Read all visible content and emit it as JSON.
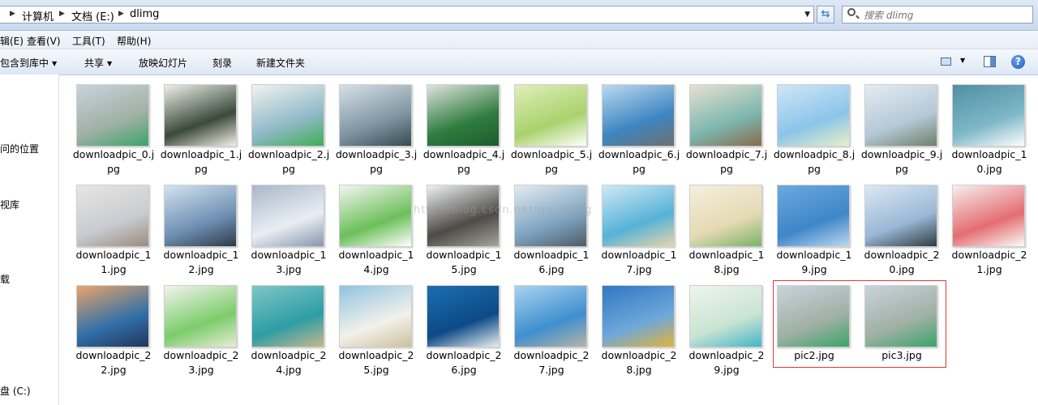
{
  "address": {
    "crumbs": [
      "计算机",
      "文档 (E:)",
      "dlimg"
    ]
  },
  "search": {
    "placeholder": "搜索 dlimg"
  },
  "menu": [
    "辑(E)",
    "查看(V)",
    "工具(T)",
    "帮助(H)"
  ],
  "toolbar": {
    "include_library": "包含到库中",
    "share": "共享",
    "slideshow": "放映幻灯片",
    "burn": "刻录",
    "new_folder": "新建文件夹"
  },
  "nav": [
    "问的位置",
    "视库",
    "载",
    "盘 (C:)"
  ],
  "watermark": "http://blog.csdn.net/qq_dlimg",
  "files": [
    {
      "name": "downloadpic_0.jpg",
      "c1": "#c9d3dc",
      "c2": "#9fb0a4",
      "c3": "#3aa56a"
    },
    {
      "name": "downloadpic_1.jpg",
      "c1": "#eef0ea",
      "c2": "#3a4a3a",
      "c3": "#f3f0e6"
    },
    {
      "name": "downloadpic_2.jpg",
      "c1": "#f1f2f0",
      "c2": "#8fb9c7",
      "c3": "#3fae56"
    },
    {
      "name": "downloadpic_3.jpg",
      "c1": "#d6e0e6",
      "c2": "#7f95a2",
      "c3": "#364a52"
    },
    {
      "name": "downloadpic_4.jpg",
      "c1": "#dfe2df",
      "c2": "#2f7d3f",
      "c3": "#1e5a2c"
    },
    {
      "name": "downloadpic_5.jpg",
      "c1": "#dfeebb",
      "c2": "#a9d26c",
      "c3": "#ffffff"
    },
    {
      "name": "downloadpic_6.jpg",
      "c1": "#bcd9ee",
      "c2": "#3d86c2",
      "c3": "#6e6f6e"
    },
    {
      "name": "downloadpic_7.jpg",
      "c1": "#e7e0d2",
      "c2": "#7cb7ae",
      "c3": "#8a6a4c"
    },
    {
      "name": "downloadpic_8.jpg",
      "c1": "#cfe6f7",
      "c2": "#8cc4ea",
      "c3": "#e9f1c7"
    },
    {
      "name": "downloadpic_9.jpg",
      "c1": "#e4ecf3",
      "c2": "#b4c8d6",
      "c3": "#6f7f68"
    },
    {
      "name": "downloadpic_10.jpg",
      "c1": "#4f8fa3",
      "c2": "#7fb8c7",
      "c3": "#ffffff"
    },
    {
      "name": "downloadpic_11.jpg",
      "c1": "#e9e6e2",
      "c2": "#c8cbd0",
      "c3": "#9a8c7e"
    },
    {
      "name": "downloadpic_12.jpg",
      "c1": "#d5e2ef",
      "c2": "#6f90b3",
      "c3": "#2e3a4b"
    },
    {
      "name": "downloadpic_13.jpg",
      "c1": "#a9b7c9",
      "c2": "#e9eef3",
      "c3": "#8596ad"
    },
    {
      "name": "downloadpic_14.jpg",
      "c1": "#f3f6ef",
      "c2": "#6cbf5a",
      "c3": "#ffffff"
    },
    {
      "name": "downloadpic_15.jpg",
      "c1": "#eef1f2",
      "c2": "#4d4b46",
      "c3": "#a7a59c"
    },
    {
      "name": "downloadpic_16.jpg",
      "c1": "#e4ebef",
      "c2": "#7fa4c1",
      "c3": "#4f5c66"
    },
    {
      "name": "downloadpic_17.jpg",
      "c1": "#cfe9f5",
      "c2": "#56b2d8",
      "c3": "#e5d5a8"
    },
    {
      "name": "downloadpic_18.jpg",
      "c1": "#f4efdf",
      "c2": "#e5dab4",
      "c3": "#7ab266"
    },
    {
      "name": "downloadpic_19.jpg",
      "c1": "#6ba9dd",
      "c2": "#3f86c9",
      "c3": "#bcd9ef"
    },
    {
      "name": "downloadpic_20.jpg",
      "c1": "#dce8f3",
      "c2": "#9ab7d6",
      "c3": "#2f3c40"
    },
    {
      "name": "downloadpic_21.jpg",
      "c1": "#f6eeee",
      "c2": "#e46d70",
      "c3": "#fbfbfb"
    },
    {
      "name": "downloadpic_22.jpg",
      "c1": "#e9a46a",
      "c2": "#2f6fa8",
      "c3": "#24345a"
    },
    {
      "name": "downloadpic_23.jpg",
      "c1": "#f2f4ee",
      "c2": "#7ccc6a",
      "c3": "#e7ecd9"
    },
    {
      "name": "downloadpic_24.jpg",
      "c1": "#7fc6c5",
      "c2": "#2e9da6",
      "c3": "#c5b88c"
    },
    {
      "name": "downloadpic_25.jpg",
      "c1": "#8fc3e3",
      "c2": "#f3f1ea",
      "c3": "#cdbf9e"
    },
    {
      "name": "downloadpic_26.jpg",
      "c1": "#1c6eb0",
      "c2": "#0d4a86",
      "c3": "#e8eef0"
    },
    {
      "name": "downloadpic_27.jpg",
      "c1": "#a9d3f0",
      "c2": "#3f8fcf",
      "c3": "#b7b3a6"
    },
    {
      "name": "downloadpic_28.jpg",
      "c1": "#2f78c3",
      "c2": "#6fa7d9",
      "c3": "#e2b43b"
    },
    {
      "name": "downloadpic_29.jpg",
      "c1": "#eef5ec",
      "c2": "#c9e4d2",
      "c3": "#42b5c8"
    },
    {
      "name": "pic2.jpg",
      "c1": "#c9d3dc",
      "c2": "#9fb0a4",
      "c3": "#3aa56a"
    },
    {
      "name": "pic3.jpg",
      "c1": "#c9d3dc",
      "c2": "#9fb0a4",
      "c3": "#3aa56a"
    }
  ]
}
